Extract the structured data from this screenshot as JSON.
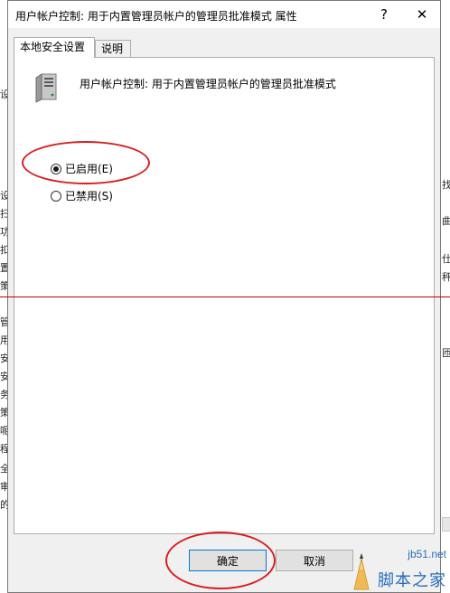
{
  "dialog": {
    "title": "用户帐户控制: 用于内置管理员帐户的管理员批准模式 属性",
    "help_label": "?",
    "close_label": "✕"
  },
  "tabs": [
    {
      "label": "本地安全设置",
      "active": true
    },
    {
      "label": "说明",
      "active": false
    }
  ],
  "policy": {
    "name": "用户帐户控制: 用于内置管理员帐户的管理员批准模式",
    "icon": "server-icon"
  },
  "options": [
    {
      "label": "已启用(E)",
      "selected": true
    },
    {
      "label": "已禁用(S)",
      "selected": false
    }
  ],
  "buttons": {
    "ok": "确定",
    "cancel": "取消"
  },
  "background_left_chars": [
    "设",
    "扫",
    "功",
    "扣",
    "置",
    "策",
    "管",
    "用",
    "安",
    "安",
    "务",
    "策",
    "呢",
    "程",
    "全",
    "审",
    "的"
  ],
  "background_right_chars": [
    "找",
    "曲",
    "仕",
    "秤",
    "匝"
  ],
  "watermark": {
    "url": "jb51.net",
    "name": "脚本之家"
  },
  "colors": {
    "annotation_red": "#d62020",
    "line_red": "#c00000",
    "accent_blue": "#0078d7",
    "watermark_blue": "#2a6ebb"
  }
}
